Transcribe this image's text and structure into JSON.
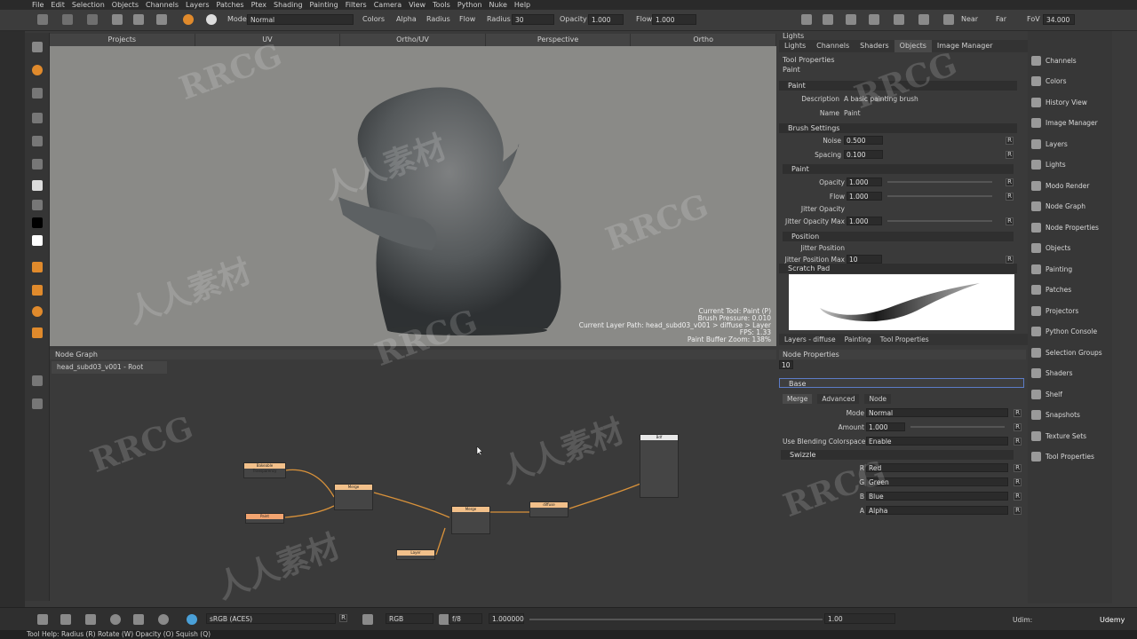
{
  "menu": [
    "File",
    "Edit",
    "Selection",
    "Objects",
    "Channels",
    "Layers",
    "Patches",
    "Ptex",
    "Shading",
    "Painting",
    "Filters",
    "Camera",
    "View",
    "Tools",
    "Python",
    "Nuke",
    "Help"
  ],
  "toolbar": {
    "mode_label": "Mode",
    "mode_value": "Normal",
    "colors_label": "Colors",
    "alpha_label": "Alpha",
    "radius_check_label": "Radius",
    "flow_check_label": "Flow",
    "radius_label": "Radius",
    "radius_value": "30",
    "opacity_label": "Opacity",
    "opacity_value": "1.000",
    "flow_label": "Flow",
    "flow_value": "1.000",
    "near_label": "Near",
    "far_label": "Far",
    "fov_label": "FoV",
    "fov_value": "34.000"
  },
  "viewport_tabs": [
    "Projects",
    "UV",
    "Ortho/UV",
    "Perspective",
    "Ortho"
  ],
  "viewport_info": {
    "line1": "Current Tool: Paint (P)",
    "line2": "Brush Pressure: 0.010",
    "line3": "Current Layer Path: head_subd03_v001 > diffuse > Layer",
    "line4": "FPS: 1.33",
    "line5": "Paint Buffer Zoom: 138%"
  },
  "right_panel": {
    "title": "Lights",
    "tabs": [
      "Lights",
      "Channels",
      "Shaders",
      "Objects",
      "Image Manager"
    ],
    "tool_properties_header": "Tool Properties",
    "tool_name": "Paint",
    "paint_section": "Paint",
    "description_label": "Description",
    "description_value": "A basic painting brush",
    "name_label": "Name",
    "name_value": "Paint",
    "brush_settings_section": "Brush Settings",
    "noise_label": "Noise",
    "noise_value": "0.500",
    "spacing_label": "Spacing",
    "spacing_value": "0.100",
    "paint_sub_section": "Paint",
    "opacity_label": "Opacity",
    "opacity_value": "1.000",
    "flow_label": "Flow",
    "flow_value": "1.000",
    "jitter_opacity_label": "Jitter Opacity",
    "jitter_opacity_max_label": "Jitter Opacity Max",
    "jitter_opacity_max_value": "1.000",
    "position_section": "Position",
    "jitter_position_label": "Jitter Position",
    "jitter_position_max_label": "Jitter Position Max",
    "jitter_position_max_value": "10",
    "scratch_pad_section": "Scratch Pad",
    "bottom_tabs": [
      "Layers - diffuse",
      "Painting",
      "Tool Properties"
    ]
  },
  "node_graph": {
    "header": "Node Graph",
    "tab": "head_subd03_v001 - Root",
    "nodes": [
      "Bakeable Transparency",
      "Merge",
      "Paint",
      "Merge",
      "diffuse",
      "Layer",
      "Bdf"
    ]
  },
  "node_properties": {
    "header": "Node Properties",
    "id_value": "10",
    "base_section": "Base",
    "tabs": [
      "Merge",
      "Advanced",
      "Node"
    ],
    "mode_label": "Mode",
    "mode_value": "Normal",
    "amount_label": "Amount",
    "amount_value": "1.000",
    "blend_label": "Use Blending Colorspace",
    "blend_value": "Enable",
    "swizzle_section": "Swizzle",
    "r_label": "R",
    "r_value": "Red",
    "g_label": "G",
    "g_value": "Green",
    "b_label": "B",
    "b_value": "Blue",
    "a_label": "A",
    "a_value": "Alpha"
  },
  "sidebar": [
    "Channels",
    "Colors",
    "History View",
    "Image Manager",
    "Layers",
    "Lights",
    "Modo Render",
    "Node Graph",
    "Node Properties",
    "Objects",
    "Painting",
    "Patches",
    "Projectors",
    "Python Console",
    "Selection Groups",
    "Shaders",
    "Shelf",
    "Snapshots",
    "Texture Sets",
    "Tool Properties"
  ],
  "bottombar": {
    "colorspace": "sRGB (ACES)",
    "channel": "RGB",
    "fstop": "f/8",
    "gain": "1.000000",
    "r_value": "1.00",
    "udim_label": "Udim:",
    "brand": "Udemy"
  },
  "statusbar": "Tool Help:   Radius (R)   Rotate (W)   Opacity (O)   Squish (Q)",
  "watermarks": [
    "RRCG",
    "人人素材"
  ],
  "colors": {
    "accent": "#e08a2c",
    "viewport_bg": "#8a8a87",
    "panel_bg": "#3a3a3a"
  }
}
